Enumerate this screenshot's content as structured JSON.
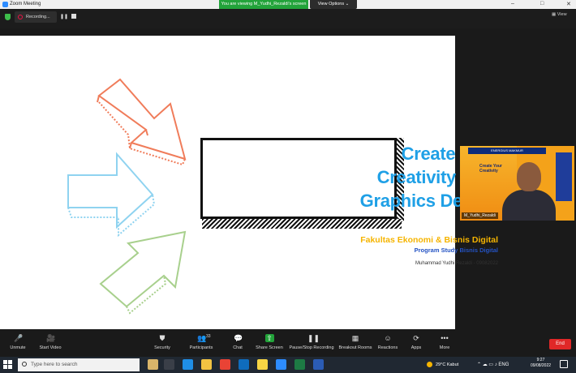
{
  "window": {
    "title": "Zoom Meeting",
    "controls": [
      "–",
      "□",
      "✕"
    ]
  },
  "banner": {
    "viewing_text": "You are viewing M_Yudhi_Rezaldi's screen",
    "view_options_label": "View Options ⌄"
  },
  "recording": {
    "label": "Recording...",
    "pause_glyph": "❚❚",
    "view_label": "View"
  },
  "slide": {
    "title_lines": [
      "Create Your",
      "Creativity With",
      "Graphics Design"
    ],
    "faculty": "Fakultas Ekonomi & Bisnis Digital",
    "program": "Program Study Bisnis Digital",
    "presenter": "Muhammad Yudhi Rezaldi - 09082022",
    "colors": {
      "title": "#1fa0e6",
      "faculty": "#f5b400",
      "program": "#2453c4",
      "arrow_top": "#f07c5a",
      "arrow_mid": "#8fd3f0",
      "arrow_bottom": "#a8d08d"
    }
  },
  "video": {
    "participant_name": "M_Yudhi_Rezaldi",
    "poster_banner": "ENERGIUS MAKMUR",
    "poster_text": "Create Your Creativity"
  },
  "toolbar": {
    "items": [
      {
        "id": "unmute",
        "label": "Unmute",
        "icon": "microphone-muted-icon",
        "glyph": "🎤"
      },
      {
        "id": "start-video",
        "label": "Start Video",
        "icon": "camera-off-icon",
        "glyph": "🎥"
      },
      {
        "id": "security",
        "label": "Security",
        "icon": "shield-icon",
        "glyph": "⛊"
      },
      {
        "id": "participants",
        "label": "Participants",
        "icon": "people-icon",
        "glyph": "👥",
        "count": "33"
      },
      {
        "id": "chat",
        "label": "Chat",
        "icon": "chat-bubble-icon",
        "glyph": "💬"
      },
      {
        "id": "share-screen",
        "label": "Share Screen",
        "icon": "share-arrow-icon",
        "glyph": "⇧"
      },
      {
        "id": "pause-stop-recording",
        "label": "Pause/Stop Recording",
        "icon": "pause-stop-icon",
        "glyph": "❚❚"
      },
      {
        "id": "breakout-rooms",
        "label": "Breakout Rooms",
        "icon": "grid-icon",
        "glyph": "▦"
      },
      {
        "id": "reactions",
        "label": "Reactions",
        "icon": "smiley-icon",
        "glyph": "☺"
      },
      {
        "id": "apps",
        "label": "Apps",
        "icon": "apps-icon",
        "glyph": "⟳"
      },
      {
        "id": "more",
        "label": "More",
        "icon": "ellipsis-icon",
        "glyph": "•••"
      }
    ],
    "end_label": "End"
  },
  "taskbar": {
    "search_placeholder": "Type here to search",
    "weather_temp": "29°C",
    "weather_text": "Kabut",
    "time": "9:27",
    "date": "09/08/2022",
    "apps": [
      {
        "name": "task-view-icon",
        "color": "#3a3f48"
      },
      {
        "name": "edge-icon",
        "color": "#1f8ee6"
      },
      {
        "name": "file-explorer-icon",
        "color": "#f3c342"
      },
      {
        "name": "chrome-icon",
        "color": "#e94335"
      },
      {
        "name": "mail-icon",
        "color": "#0f6cbd"
      },
      {
        "name": "sticky-notes-icon",
        "color": "#f7d544"
      },
      {
        "name": "zoom-icon",
        "color": "#2d8cff"
      },
      {
        "name": "excel-icon",
        "color": "#1d7a44"
      },
      {
        "name": "word-icon",
        "color": "#2b5cb5"
      }
    ]
  }
}
